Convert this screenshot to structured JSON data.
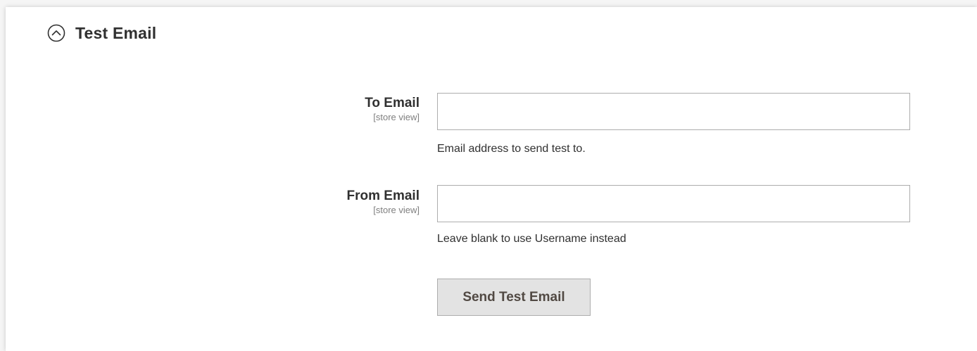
{
  "section": {
    "title": "Test Email",
    "toggle_icon": "chevron-up-circle-icon"
  },
  "fields": {
    "to_email": {
      "label": "To Email",
      "scope": "[store view]",
      "value": "",
      "placeholder": "",
      "note": "Email address to send test to."
    },
    "from_email": {
      "label": "From Email",
      "scope": "[store view]",
      "value": "",
      "placeholder": "",
      "note": "Leave blank to use Username instead"
    }
  },
  "actions": {
    "send_label": "Send Test Email"
  },
  "colors": {
    "text": "#303030",
    "scope_text": "#808080",
    "input_border": "#adadad",
    "button_bg": "#e3e3e3",
    "button_text": "#514943"
  }
}
